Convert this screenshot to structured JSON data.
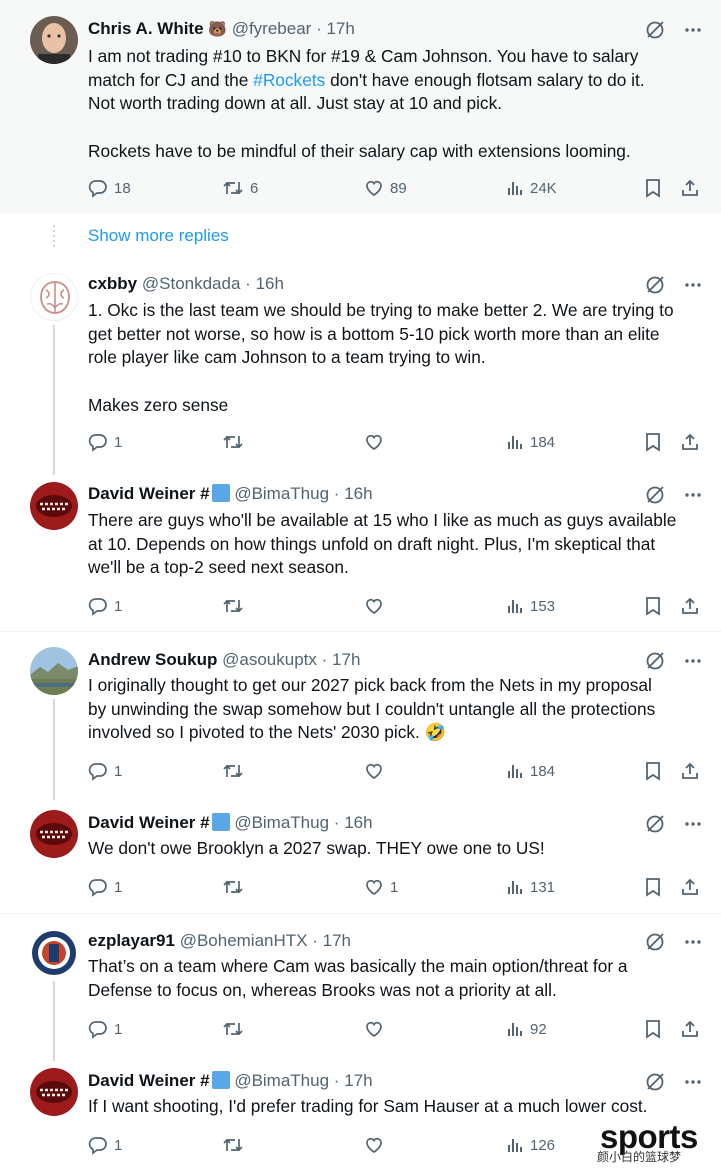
{
  "tweets": [
    {
      "name": "Chris A. White",
      "name_emoji": "🐻",
      "handle": "@fyrebear",
      "time": "17h",
      "lines": [
        "I am not trading #10 to BKN for #19 & Cam Johnson. You have to salary",
        "match for CJ and the ",
        "#Rockets",
        " don't have enough flotsam salary to do it.",
        "Not worth trading down at all. Just stay at 10 and pick.",
        "Rockets have to be mindful of their salary cap with extensions looming."
      ],
      "replies": "18",
      "retweets": "6",
      "likes": "89",
      "views": "24K"
    },
    {
      "name": "cxbby",
      "handle": "@Stonkdada",
      "time": "16h",
      "lines": [
        "1. Okc is the last team we should be trying to make better 2. We are trying to",
        "get better not worse, so how is a bottom 5-10 pick worth more than an elite",
        "role player like cam Johnson to a team trying to win.",
        "Makes zero sense"
      ],
      "replies": "1",
      "retweets": "",
      "likes": "",
      "views": "184"
    },
    {
      "name": "David Weiner #",
      "handle": "@BimaThug",
      "time": "16h",
      "lines": [
        "There are guys who'll be available at 15 who I like as much as guys available",
        "at 10. Depends on how things unfold on draft night. Plus, I'm skeptical that",
        "we'll be a top-2 seed next season."
      ],
      "replies": "1",
      "retweets": "",
      "likes": "",
      "views": "153"
    },
    {
      "name": "Andrew Soukup",
      "handle": "@asoukuptx",
      "time": "17h",
      "lines": [
        "I originally thought to get our 2027 pick back from the Nets in my proposal",
        "by unwinding the swap somehow but I couldn't untangle all the protections",
        "involved so I pivoted to the Nets' 2030 pick. 🤣"
      ],
      "replies": "1",
      "retweets": "",
      "likes": "",
      "views": "184"
    },
    {
      "name": "David Weiner #",
      "handle": "@BimaThug",
      "time": "16h",
      "lines": [
        "We don't owe Brooklyn a 2027 swap. THEY owe one to US!"
      ],
      "replies": "1",
      "retweets": "",
      "likes": "1",
      "views": "131"
    },
    {
      "name": "ezplayar91",
      "handle": "@BohemianHTX",
      "time": "17h",
      "lines": [
        "That’s on a team where Cam was basically the main option/threat for a",
        "Defense to focus on, whereas Brooks was not a priority at all."
      ],
      "replies": "1",
      "retweets": "",
      "likes": "",
      "views": "92"
    },
    {
      "name": "David Weiner #",
      "handle": "@BimaThug",
      "time": "17h",
      "lines": [
        "If I want shooting, I'd prefer trading for Sam Hauser at a much lower cost."
      ],
      "replies": "1",
      "retweets": "",
      "likes": "",
      "views": "126"
    }
  ],
  "show_more_replies": "Show more replies",
  "watermark": {
    "brand": "sports",
    "sub": "颜小白的篮球梦"
  },
  "colors": {
    "accent": "#1d9bf0",
    "secondary_text": "#536471",
    "highlight_bg": "#f7f9f9"
  }
}
